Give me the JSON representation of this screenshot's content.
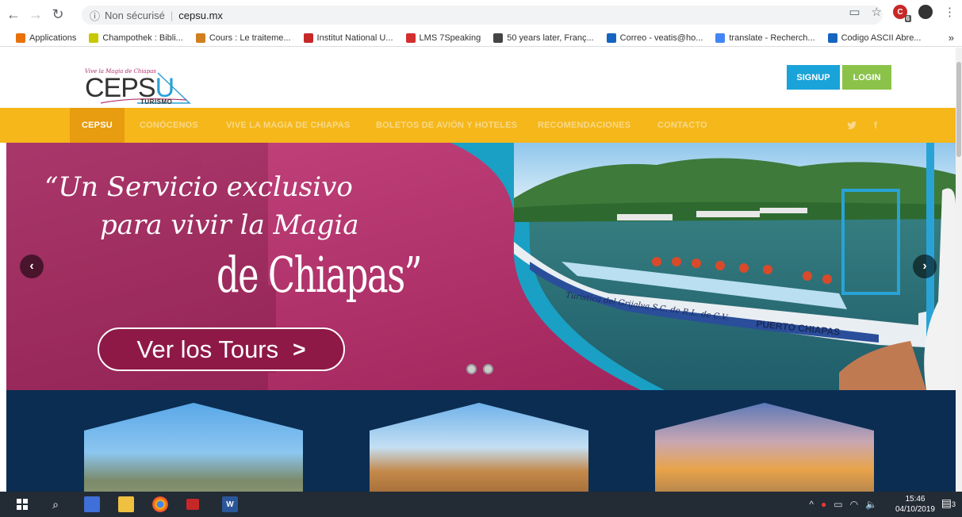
{
  "browser": {
    "security_label": "Non sécurisé",
    "url": "cepsu.mx",
    "extension_badge": "6"
  },
  "bookmarks": [
    {
      "label": "Applications",
      "icon": "apps-grid-icon",
      "color": "#e8710a"
    },
    {
      "label": "Champothek : Bibli...",
      "icon": "lc-icon",
      "color": "#c8c800"
    },
    {
      "label": "Cours : Le traiteme...",
      "icon": "m-icon",
      "color": "#d08020"
    },
    {
      "label": "Institut National U...",
      "icon": "lc-icon",
      "color": "#c62828"
    },
    {
      "label": "LMS 7Speaking",
      "icon": "seven-icon",
      "color": "#d32f2f"
    },
    {
      "label": "50 years later, Franç...",
      "icon": "globe-icon",
      "color": "#444444"
    },
    {
      "label": "Correo - veatis@ho...",
      "icon": "outlook-icon",
      "color": "#1565c0"
    },
    {
      "label": "translate - Recherch...",
      "icon": "google-icon",
      "color": "#4285f4"
    },
    {
      "label": "Codigo ASCII Abre...",
      "icon": "play-icon",
      "color": "#1565c0"
    }
  ],
  "bookmarks_more": "»",
  "site": {
    "logo_tagline": "Vive la Magia de Chiapas",
    "logo_main": "CEPS",
    "logo_main_u": "U",
    "logo_sub": "TURISMO",
    "signup_label": "SIGNUP",
    "login_label": "LOGIN"
  },
  "nav": [
    {
      "label": "CEPSU",
      "active": true
    },
    {
      "label": "CONÓCENOS"
    },
    {
      "label": "VIVE LA MAGIA DE CHIAPAS"
    },
    {
      "label": "BOLETOS DE AVIÓN Y HOTELES"
    },
    {
      "label": "RECOMENDACIONES"
    },
    {
      "label": "CONTACTO"
    }
  ],
  "social": {
    "twitter": "🐦",
    "facebook": "f"
  },
  "hero": {
    "line1": "“Un Servicio exclusivo",
    "line2": "para vivir la Magia",
    "line3": "de Chiapas”",
    "cta_label": "Ver los Tours",
    "cta_chevron": ">",
    "prev_label": "‹",
    "next_label": "›",
    "boat_text": "Turística del Grijalva S.C. de R.L. de C.V.",
    "boat_port": "PUERTO CHIAPAS"
  },
  "taskbar": {
    "time": "15:46",
    "date": "04/10/2019",
    "notification_count": "3"
  }
}
